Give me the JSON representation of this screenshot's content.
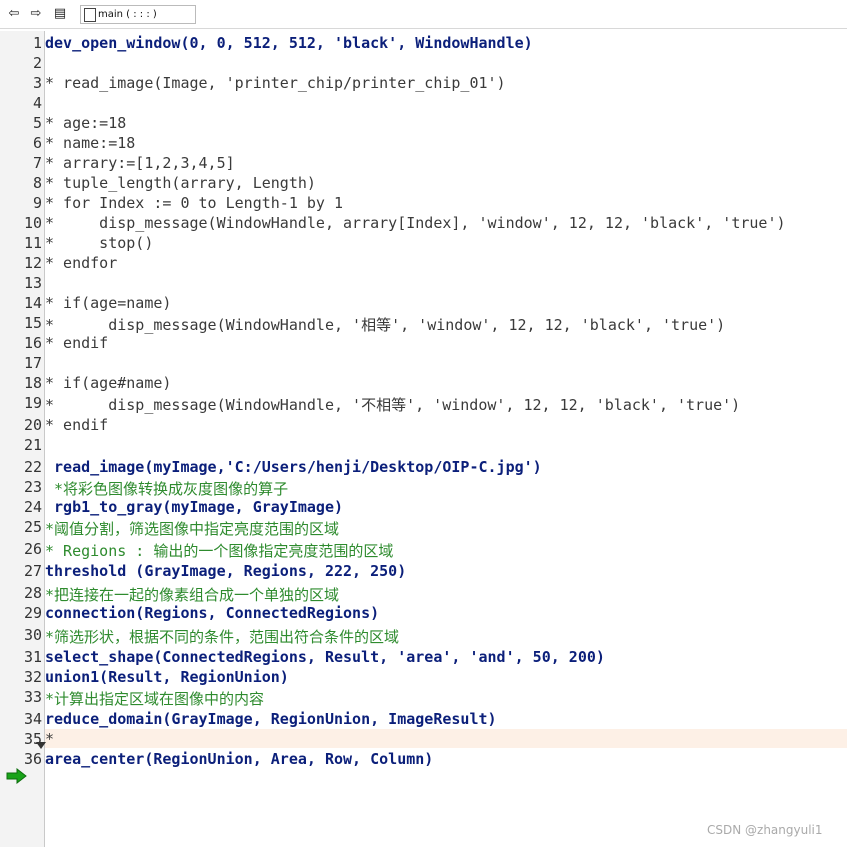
{
  "toolbar": {
    "back_icon": "left-arrow-icon",
    "forward_icon": "right-arrow-icon",
    "procedure_label": "main ( : : : )"
  },
  "editor": {
    "lines": [
      {
        "num": "1",
        "text": "dev_open_window(0, 0, 512, 512, 'black', WindowHandle)",
        "kind": "active"
      },
      {
        "num": "2",
        "text": "",
        "kind": "plain"
      },
      {
        "num": "3",
        "text": "* read_image(Image, 'printer_chip/printer_chip_01')",
        "kind": "plain"
      },
      {
        "num": "4",
        "text": "",
        "kind": "plain"
      },
      {
        "num": "5",
        "text": "* age:=18",
        "kind": "plain"
      },
      {
        "num": "6",
        "text": "* name:=18",
        "kind": "plain"
      },
      {
        "num": "7",
        "text": "* arrary:=[1,2,3,4,5]",
        "kind": "plain"
      },
      {
        "num": "8",
        "text": "* tuple_length(arrary, Length)",
        "kind": "plain"
      },
      {
        "num": "9",
        "text": "* for Index := 0 to Length-1 by 1",
        "kind": "plain"
      },
      {
        "num": "10",
        "text": "*     disp_message(WindowHandle, arrary[Index], 'window', 12, 12, 'black', 'true')",
        "kind": "plain"
      },
      {
        "num": "11",
        "text": "*     stop()",
        "kind": "plain"
      },
      {
        "num": "12",
        "text": "* endfor",
        "kind": "plain"
      },
      {
        "num": "13",
        "text": "",
        "kind": "plain"
      },
      {
        "num": "14",
        "text": "* if(age=name)",
        "kind": "plain"
      },
      {
        "num": "15",
        "text": "*      disp_message(WindowHandle, '相等', 'window', 12, 12, 'black', 'true')",
        "kind": "plain"
      },
      {
        "num": "16",
        "text": "* endif",
        "kind": "plain"
      },
      {
        "num": "17",
        "text": "",
        "kind": "plain"
      },
      {
        "num": "18",
        "text": "* if(age#name)",
        "kind": "plain"
      },
      {
        "num": "19",
        "text": "*      disp_message(WindowHandle, '不相等', 'window', 12, 12, 'black', 'true')",
        "kind": "plain"
      },
      {
        "num": "20",
        "text": "* endif",
        "kind": "plain"
      },
      {
        "num": "21",
        "text": "",
        "kind": "plain"
      },
      {
        "num": "22",
        "text": " read_image(myImage,'C:/Users/henji/Desktop/OIP-C.jpg')",
        "kind": "active"
      },
      {
        "num": "23",
        "text": " *将彩色图像转换成灰度图像的算子",
        "kind": "comment"
      },
      {
        "num": "24",
        "text": " rgb1_to_gray(myImage, GrayImage)",
        "kind": "active"
      },
      {
        "num": "25",
        "text": "*阈值分割，筛选图像中指定亮度范围的区域",
        "kind": "comment"
      },
      {
        "num": "26",
        "text": "* Regions : 输出的一个图像指定亮度范围的区域",
        "kind": "comment"
      },
      {
        "num": "27",
        "text": "threshold (GrayImage, Regions, 222, 250)",
        "kind": "active"
      },
      {
        "num": "28",
        "text": "*把连接在一起的像素组合成一个单独的区域",
        "kind": "comment"
      },
      {
        "num": "29",
        "text": "connection(Regions, ConnectedRegions)",
        "kind": "active"
      },
      {
        "num": "30",
        "text": "*筛选形状，根据不同的条件，范围出符合条件的区域",
        "kind": "comment"
      },
      {
        "num": "31",
        "text": "select_shape(ConnectedRegions, Result, 'area', 'and', 50, 200)",
        "kind": "active"
      },
      {
        "num": "32",
        "text": "union1(Result, RegionUnion)",
        "kind": "active"
      },
      {
        "num": "33",
        "text": "*计算出指定区域在图像中的内容",
        "kind": "comment"
      },
      {
        "num": "34",
        "text": "reduce_domain(GrayImage, RegionUnion, ImageResult)",
        "kind": "active"
      },
      {
        "num": "35",
        "text": "*",
        "kind": "plain"
      },
      {
        "num": "36",
        "text": "area_center(RegionUnion, Area, Row, Column)",
        "kind": "active"
      }
    ]
  },
  "pc_marker_icon": "program-counter-arrow-icon",
  "watermark": "CSDN @zhangyuli1",
  "colors": {
    "active_code": "#0b1f7a",
    "comment": "#2e8b2e",
    "commented_out": "#3a3a3a",
    "current_line_bg": "#fdf0e6"
  }
}
